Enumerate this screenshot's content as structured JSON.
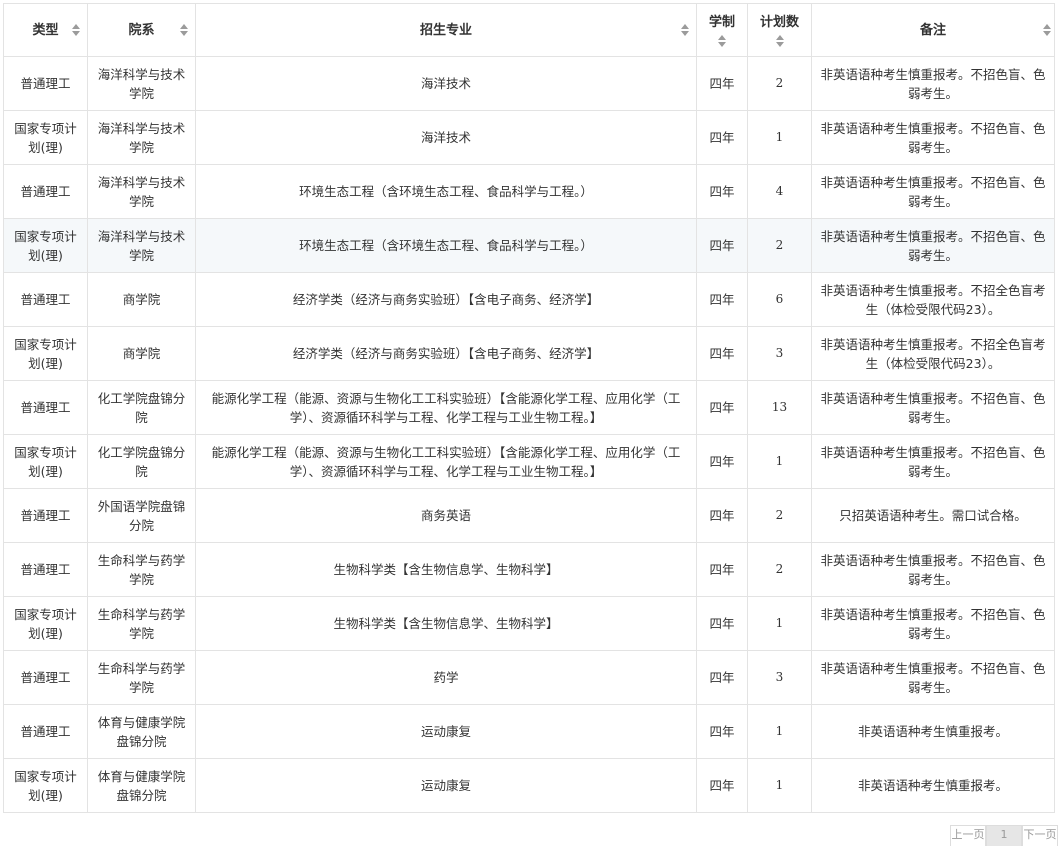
{
  "table": {
    "headers": {
      "type": "类型",
      "dept": "院系",
      "major": "招生专业",
      "years": "学制",
      "plan": "计划数",
      "note": "备注"
    },
    "rows": [
      {
        "type": "普通理工",
        "dept": "海洋科学与技术学院",
        "major": "海洋技术",
        "years": "四年",
        "plan": "2",
        "note": "非英语语种考生慎重报考。不招色盲、色弱考生。"
      },
      {
        "type": "国家专项计划(理)",
        "dept": "海洋科学与技术学院",
        "major": "海洋技术",
        "years": "四年",
        "plan": "1",
        "note": "非英语语种考生慎重报考。不招色盲、色弱考生。"
      },
      {
        "type": "普通理工",
        "dept": "海洋科学与技术学院",
        "major": "环境生态工程（含环境生态工程、食品科学与工程。）",
        "years": "四年",
        "plan": "4",
        "note": "非英语语种考生慎重报考。不招色盲、色弱考生。"
      },
      {
        "type": "国家专项计划(理)",
        "dept": "海洋科学与技术学院",
        "major": "环境生态工程（含环境生态工程、食品科学与工程。）",
        "years": "四年",
        "plan": "2",
        "note": "非英语语种考生慎重报考。不招色盲、色弱考生。"
      },
      {
        "type": "普通理工",
        "dept": "商学院",
        "major": "经济学类（经济与商务实验班）【含电子商务、经济学】",
        "years": "四年",
        "plan": "6",
        "note": "非英语语种考生慎重报考。不招全色盲考生（体检受限代码23）。"
      },
      {
        "type": "国家专项计划(理)",
        "dept": "商学院",
        "major": "经济学类（经济与商务实验班）【含电子商务、经济学】",
        "years": "四年",
        "plan": "3",
        "note": "非英语语种考生慎重报考。不招全色盲考生（体检受限代码23）。"
      },
      {
        "type": "普通理工",
        "dept": "化工学院盘锦分院",
        "major": "能源化学工程（能源、资源与生物化工工科实验班）【含能源化学工程、应用化学（工学）、资源循环科学与工程、化学工程与工业生物工程。】",
        "years": "四年",
        "plan": "13",
        "note": "非英语语种考生慎重报考。不招色盲、色弱考生。"
      },
      {
        "type": "国家专项计划(理)",
        "dept": "化工学院盘锦分院",
        "major": "能源化学工程（能源、资源与生物化工工科实验班）【含能源化学工程、应用化学（工学）、资源循环科学与工程、化学工程与工业生物工程。】",
        "years": "四年",
        "plan": "1",
        "note": "非英语语种考生慎重报考。不招色盲、色弱考生。"
      },
      {
        "type": "普通理工",
        "dept": "外国语学院盘锦分院",
        "major": "商务英语",
        "years": "四年",
        "plan": "2",
        "note": "只招英语语种考生。需口试合格。"
      },
      {
        "type": "普通理工",
        "dept": "生命科学与药学学院",
        "major": "生物科学类【含生物信息学、生物科学】",
        "years": "四年",
        "plan": "2",
        "note": "非英语语种考生慎重报考。不招色盲、色弱考生。"
      },
      {
        "type": "国家专项计划(理)",
        "dept": "生命科学与药学学院",
        "major": "生物科学类【含生物信息学、生物科学】",
        "years": "四年",
        "plan": "1",
        "note": "非英语语种考生慎重报考。不招色盲、色弱考生。"
      },
      {
        "type": "普通理工",
        "dept": "生命科学与药学学院",
        "major": "药学",
        "years": "四年",
        "plan": "3",
        "note": "非英语语种考生慎重报考。不招色盲、色弱考生。"
      },
      {
        "type": "普通理工",
        "dept": "体育与健康学院盘锦分院",
        "major": "运动康复",
        "years": "四年",
        "plan": "1",
        "note": "非英语语种考生慎重报考。"
      },
      {
        "type": "国家专项计划(理)",
        "dept": "体育与健康学院盘锦分院",
        "major": "运动康复",
        "years": "四年",
        "plan": "1",
        "note": "非英语语种考生慎重报考。"
      }
    ]
  },
  "pagination": {
    "buttons": [
      "上一页",
      "1",
      "下一页"
    ]
  },
  "colors": {
    "border": "#e3e3e3",
    "alt_row": "#f5f8fa",
    "sort_icon": "#9b9b9b"
  },
  "icons": {
    "sort": "sort-both-icon"
  }
}
